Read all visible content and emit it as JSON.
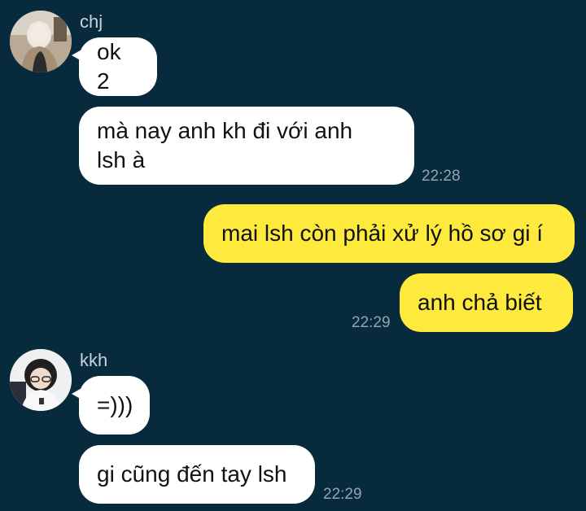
{
  "conversation": {
    "groups": [
      {
        "sender": "chj",
        "messages": [
          "ok 2",
          "mà nay anh kh đi với anh lsh à"
        ],
        "time": "22:28"
      },
      {
        "sender": "",
        "messages": [
          "mai lsh còn phải xử lý hồ sơ gi í",
          "anh chả biết"
        ],
        "time": "22:29"
      },
      {
        "sender": "kkh",
        "messages": [
          "=)))",
          "gi cũng đến tay lsh"
        ],
        "time": "22:29"
      }
    ]
  },
  "colors": {
    "background": "#072a3c",
    "incoming_bubble": "#ffffff",
    "outgoing_bubble": "#fdea3c",
    "timestamp": "#93a4ae"
  },
  "icons": {
    "avatar_1": "avatar-photo-hooded-person",
    "avatar_2": "avatar-photo-person-with-glasses"
  }
}
